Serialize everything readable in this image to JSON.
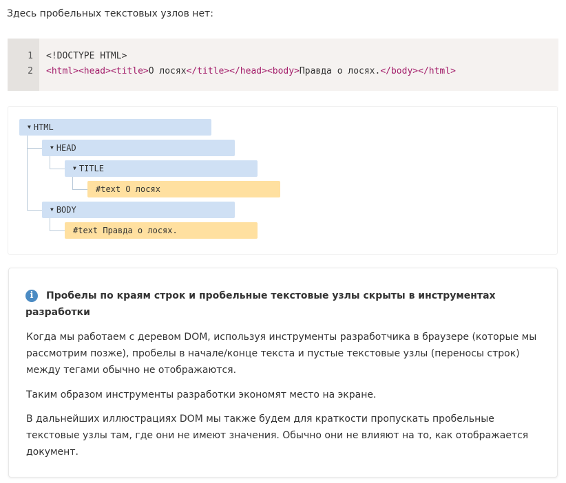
{
  "intro": "Здесь пробельных текстовых узлов нет:",
  "code": {
    "line_numbers": [
      "1",
      "2"
    ],
    "line1": {
      "open": "<!",
      "doctype": "DOCTYPE HTML",
      "close": ">"
    },
    "line2": {
      "html_open": "html",
      "head_open": "head",
      "title_open": "title",
      "title_text": "О лосях",
      "title_close": "/title",
      "head_close": "/head",
      "body_open": "body",
      "body_text": "Правда о лосях.",
      "body_close": "/body",
      "html_close": "/html"
    }
  },
  "dom_tree": {
    "html": "HTML",
    "head": "HEAD",
    "title": "TITLE",
    "title_text": "#text О лосях",
    "body": "BODY",
    "body_text": "#text Правда о лосях."
  },
  "info": {
    "icon": "info-icon",
    "title": "Пробелы по краям строк и пробельные текстовые узлы скрыты в инструментах разработки",
    "paragraphs": [
      "Когда мы работаем с деревом DOM, используя инструменты разработчика в браузере (которые мы рассмотрим позже), пробелы в начале/конце текста и пустые текстовые узлы (переносы строк) между тегами обычно не отображаются.",
      "Таким образом инструменты разработки экономят место на экране.",
      "В дальнейших иллюстрациях DOM мы также будем для краткости пропускать пробельные текстовые узлы там, где они не имеют значения. Обычно они не влияют на то, как отображается документ."
    ]
  },
  "colors": {
    "element_node": "#cfe0f4",
    "text_node": "#ffe0a0",
    "tag": "#a31d6a",
    "info_icon": "#4b8bc3"
  }
}
